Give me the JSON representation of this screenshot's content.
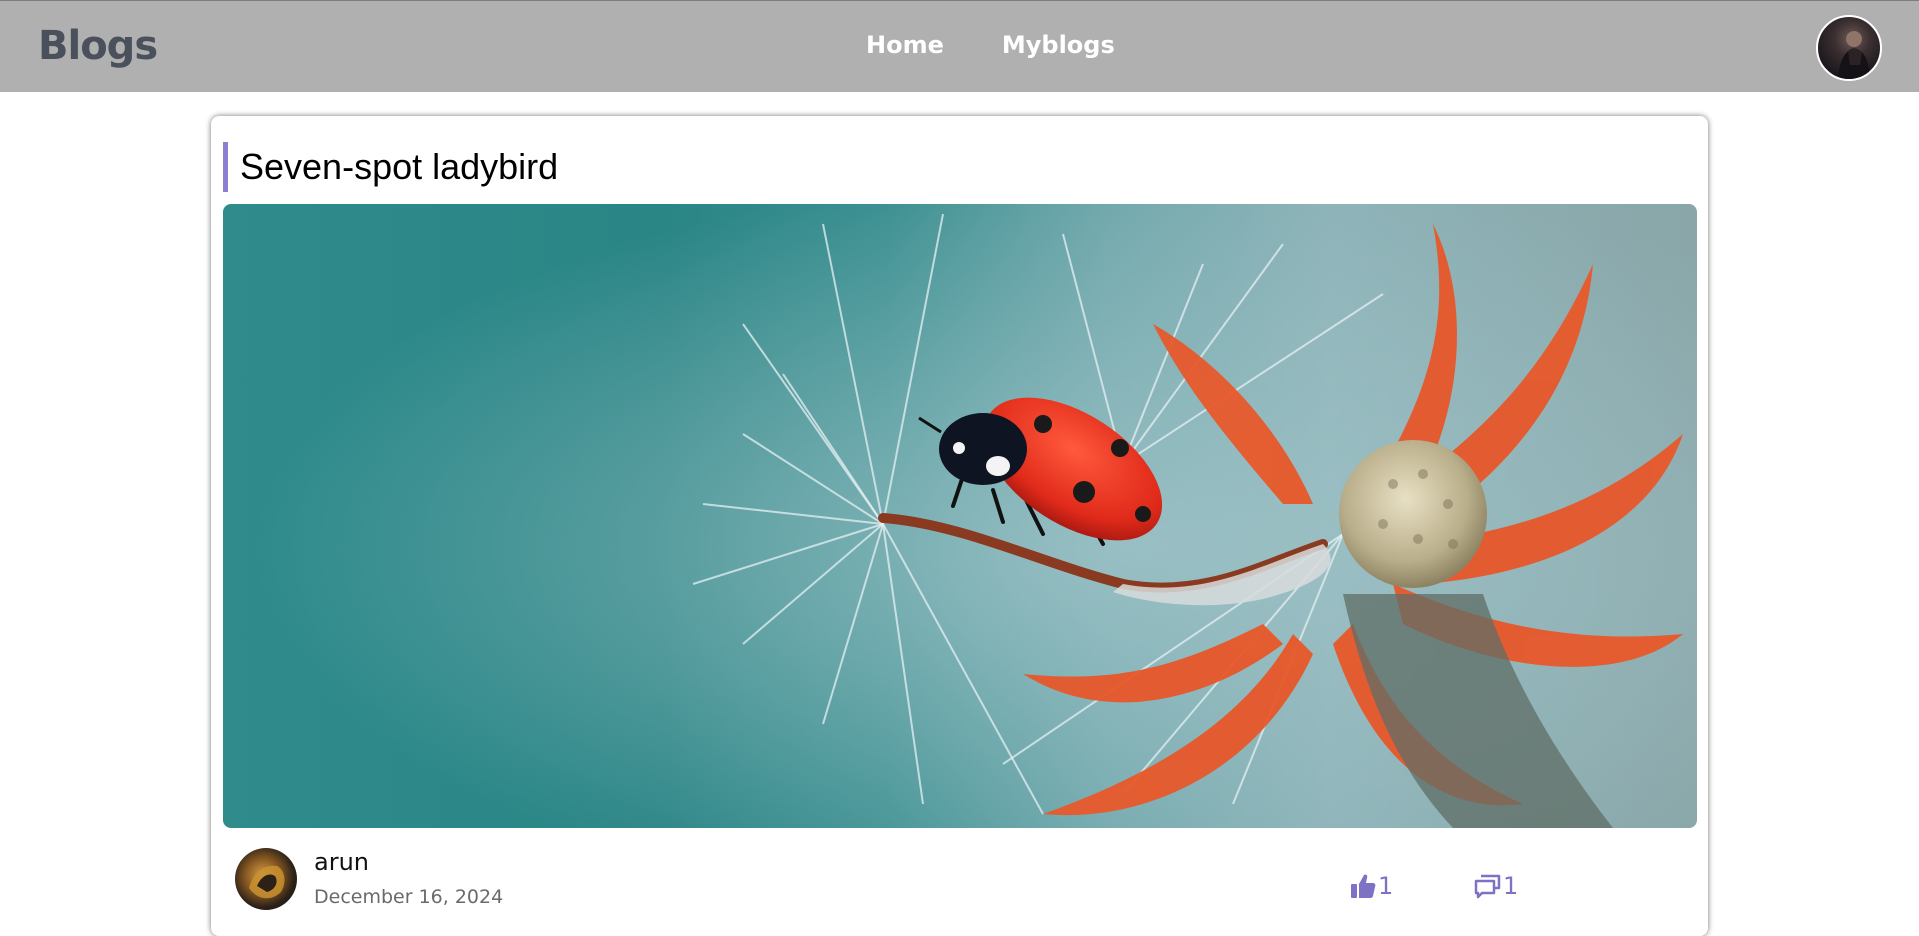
{
  "header": {
    "brand": "Blogs",
    "nav": {
      "home": "Home",
      "myblogs": "Myblogs"
    },
    "avatar_icon": "user-avatar"
  },
  "post": {
    "title": "Seven-spot ladybird",
    "image_icon": "ladybird-on-dandelion-photo",
    "author": {
      "name": "arun",
      "avatar_icon": "author-avatar"
    },
    "date": "December 16, 2024",
    "likes": {
      "icon": "thumbs-up-icon",
      "count": "1"
    },
    "comments": {
      "icon": "comment-icon",
      "count": "1"
    }
  },
  "colors": {
    "navbar_bg": "#b0b0b0",
    "brand": "#4a505c",
    "accent": "#8a7fd1",
    "stat": "#7d72c4"
  }
}
